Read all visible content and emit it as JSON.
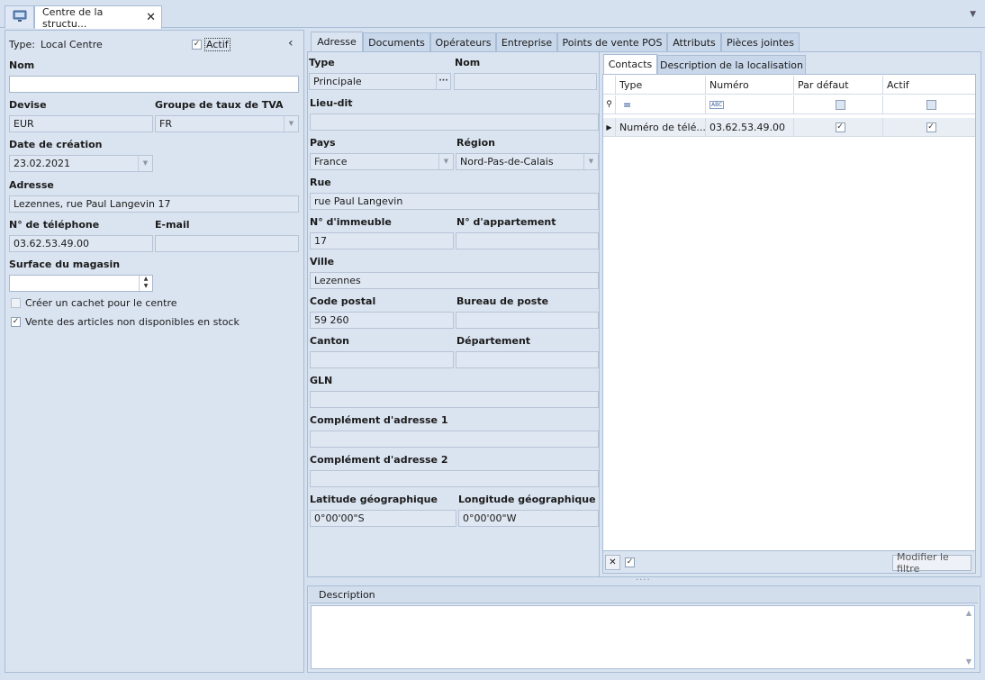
{
  "window": {
    "tab_title": "Centre de la structu...",
    "close_glyph": "✕",
    "menu_glyph": "▼"
  },
  "left": {
    "type_label": "Type:",
    "type_value": "Local Centre",
    "actif_label": "Actif",
    "actif_checked": true,
    "collapse_glyph": "‹",
    "nom_label": "Nom",
    "nom_value": "",
    "devise_label": "Devise",
    "devise_value": "EUR",
    "tva_label": "Groupe de taux de TVA",
    "tva_value": "FR",
    "date_label": "Date de création",
    "date_value": "23.02.2021",
    "adresse_label": "Adresse",
    "adresse_value": "Lezennes, rue Paul Langevin 17",
    "tel_label": "N° de téléphone",
    "tel_value": "03.62.53.49.00",
    "email_label": "E-mail",
    "email_value": "",
    "surface_label": "Surface du magasin",
    "surface_value": "",
    "cachet_label": "Créer un cachet pour le centre",
    "cachet_checked": false,
    "vente_label": "Vente des articles non disponibles en stock",
    "vente_checked": true
  },
  "tabs": [
    {
      "label": "Adresse",
      "active": true
    },
    {
      "label": "Documents"
    },
    {
      "label": "Opérateurs"
    },
    {
      "label": "Entreprise"
    },
    {
      "label": "Points de vente POS"
    },
    {
      "label": "Attributs"
    },
    {
      "label": "Pièces jointes"
    }
  ],
  "address": {
    "type_label": "Type",
    "type_value": "Principale",
    "nom_label": "Nom",
    "nom_value": "",
    "lieu_label": "Lieu-dit",
    "lieu_value": "",
    "pays_label": "Pays",
    "pays_value": "France",
    "region_label": "Région",
    "region_value": "Nord-Pas-de-Calais",
    "rue_label": "Rue",
    "rue_value": "rue Paul Langevin",
    "immeuble_label": "N° d'immeuble",
    "immeuble_value": "17",
    "appart_label": "N° d'appartement",
    "appart_value": "",
    "ville_label": "Ville",
    "ville_value": "Lezennes",
    "cp_label": "Code postal",
    "cp_value": "59 260",
    "bureau_label": "Bureau de poste",
    "bureau_value": "",
    "canton_label": "Canton",
    "canton_value": "",
    "dept_label": "Département",
    "dept_value": "",
    "gln_label": "GLN",
    "gln_value": "",
    "comp1_label": "Complément d'adresse 1",
    "comp1_value": "",
    "comp2_label": "Complément d'adresse 2",
    "comp2_value": "",
    "lat_label": "Latitude géographique",
    "lat_value": "0°00'00\"S",
    "lon_label": "Longitude géographique",
    "lon_value": "0°00'00\"W",
    "ellipsis_glyph": "···"
  },
  "contacts": {
    "subtabs": [
      {
        "label": "Contacts",
        "active": true
      },
      {
        "label": "Description de la localisation"
      }
    ],
    "columns": [
      "Type",
      "Numéro",
      "Par défaut",
      "Actif"
    ],
    "filter_type_glyph": "=",
    "filter_abc": "ABC",
    "rows": [
      {
        "type": "Numéro de télé...",
        "numero": "03.62.53.49.00",
        "par_defaut": true,
        "actif": true
      }
    ],
    "modifier_filtre_label": "Modifier le filtre"
  },
  "description": {
    "label": "Description",
    "value": ""
  },
  "splitter_glyph": "····"
}
